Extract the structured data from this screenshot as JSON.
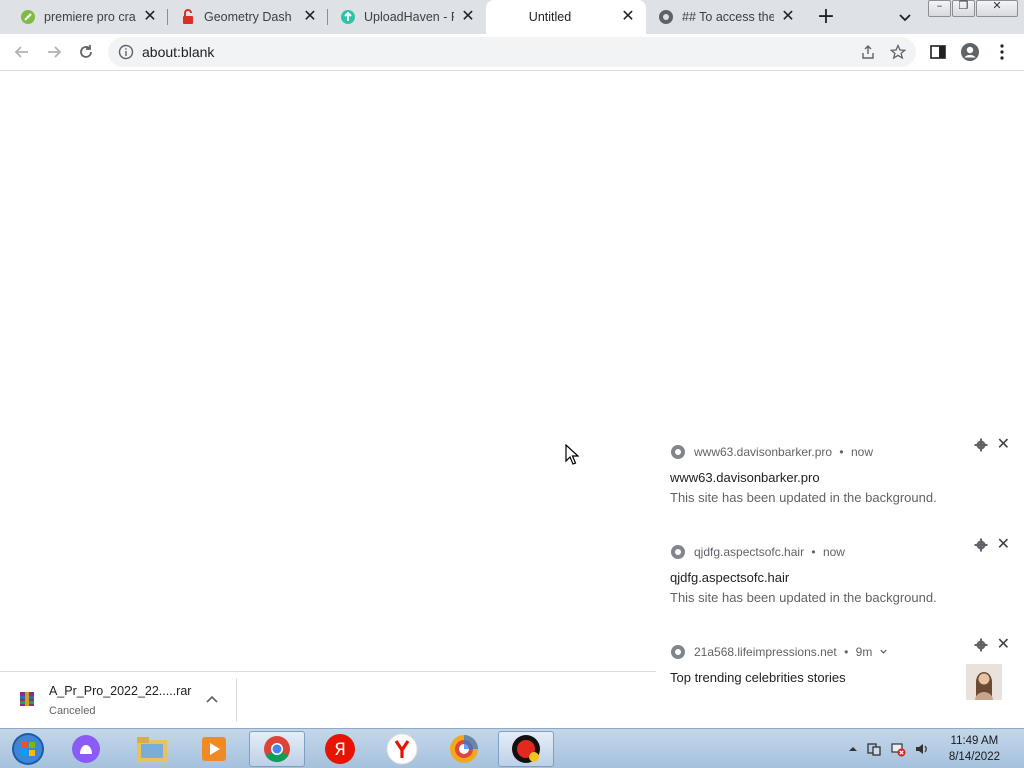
{
  "browser": {
    "tabs": [
      {
        "title": "premiere pro crac",
        "icon": "green-leaf-icon"
      },
      {
        "title": "Geometry Dash F",
        "icon": "red-lock-icon"
      },
      {
        "title": "UploadHaven - Fi",
        "icon": "uploadhaven-icon"
      },
      {
        "title": "Untitled",
        "icon": "none",
        "active": true
      },
      {
        "title": "## To access the",
        "icon": "globe-icon"
      }
    ],
    "new_tab_symbol": "+",
    "tab_close_symbol": "✕",
    "address": "about:blank"
  },
  "window_controls": {
    "minimize": "–",
    "restore": "❐",
    "close": "✕"
  },
  "notifications": [
    {
      "origin": "www63.davisonbarker.pro",
      "time": "now",
      "title": "www63.davisonbarker.pro",
      "message": "This site has been updated in the background."
    },
    {
      "origin": "qjdfg.aspectsofc.hair",
      "time": "now",
      "title": "qjdfg.aspectsofc.hair",
      "message": "This site has been updated in the background."
    },
    {
      "origin": "21a568.lifeimpressions.net",
      "time": "9m",
      "title": "Top trending celebrities stories",
      "message": "",
      "has_thumbnail": true
    }
  ],
  "notification_time_sep": "•",
  "notification_close": "✕",
  "download": {
    "filename": "A_Pr_Pro_2022_22.....rar",
    "status": "Canceled"
  },
  "taskbar": {
    "apps": [
      "start-orb",
      "alice-assistant",
      "explorer",
      "media-player",
      "chrome",
      "yandex-ya",
      "yandex-browser",
      "shield-app",
      "recorder"
    ],
    "time": "11:49 AM",
    "date": "8/14/2022"
  },
  "colors": {
    "tabstrip": "#dee1e6",
    "taskbar": "#b4cbe3",
    "accent": "#1a73e8"
  }
}
